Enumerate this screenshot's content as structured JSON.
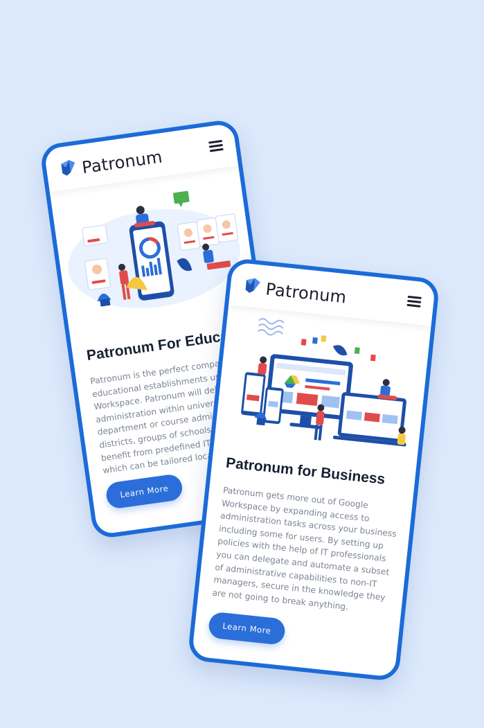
{
  "colors": {
    "background": "#dce9fc",
    "phone_border": "#1b6bd8",
    "button": "#2b6ed9",
    "title": "#162033",
    "body_text": "#7b8493"
  },
  "phone_education": {
    "brand": "Patronum",
    "title": "Patronum For Educat",
    "body_lines": [
      "Patronum is the perfect companio",
      "educational establishments using",
      "Workspace. Patronum will delega",
      "administration within universitie",
      "department or course administ",
      "districts, groups of schools or a",
      "benefit from predefined IT ad",
      "which can be tailored locally"
    ],
    "button_label": "Learn More",
    "menu_icon": "hamburger-menu-icon",
    "logo_icon": "patronum-logo-icon"
  },
  "phone_business": {
    "brand": "Patronum",
    "title": "Patronum for Business",
    "body": "Patronum gets more out of Google Workspace by expanding access to administration tasks across your business including some for users. By setting up policies with the help of IT professionals you can delegate and automate a subset of administrative capabilities to non-IT managers, secure in the knowledge they are not going to break anything.",
    "button_label": "Learn More",
    "menu_icon": "hamburger-menu-icon",
    "logo_icon": "patronum-logo-icon"
  }
}
